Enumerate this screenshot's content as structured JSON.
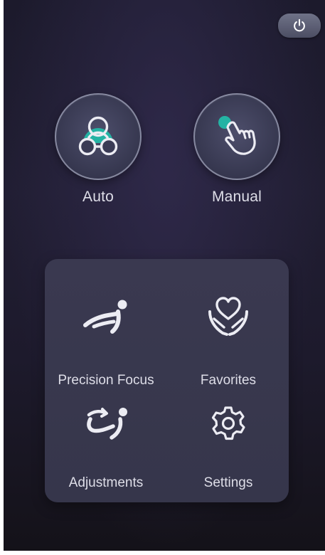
{
  "power": {
    "icon": "power-icon"
  },
  "modes": {
    "auto": {
      "label": "Auto",
      "icon": "auto-mode-icon"
    },
    "manual": {
      "label": "Manual",
      "icon": "manual-hand-icon"
    }
  },
  "menu": {
    "items": [
      {
        "label": "Precision Focus",
        "icon": "reclined-chair-person-icon"
      },
      {
        "label": "Favorites",
        "icon": "heart-hands-icon"
      },
      {
        "label": "Adjustments",
        "icon": "chair-adjust-icon"
      },
      {
        "label": "Settings",
        "icon": "gear-icon"
      }
    ]
  },
  "colors": {
    "accent": "#24b3a4",
    "background": "#1f1c2f",
    "panel": "#38374d",
    "text": "#dedee8"
  }
}
